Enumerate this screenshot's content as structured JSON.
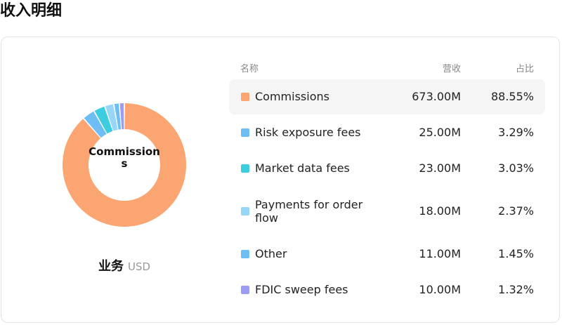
{
  "page": {
    "title": "收入明细"
  },
  "legend_caption": {
    "label": "业务",
    "currency": "USD"
  },
  "table": {
    "headers": {
      "name": "名称",
      "revenue": "营收",
      "share": "占比"
    },
    "rows": [
      {
        "name": "Commissions",
        "revenue": "673.00M",
        "share": "88.55%",
        "active": true
      },
      {
        "name": "Risk exposure fees",
        "revenue": "25.00M",
        "share": "3.29%",
        "active": false
      },
      {
        "name": "Market data fees",
        "revenue": "23.00M",
        "share": "3.03%",
        "active": false
      },
      {
        "name": "Payments for order flow",
        "revenue": "18.00M",
        "share": "2.37%",
        "active": false
      },
      {
        "name": "Other",
        "revenue": "11.00M",
        "share": "1.45%",
        "active": false
      },
      {
        "name": "FDIC sweep fees",
        "revenue": "10.00M",
        "share": "1.32%",
        "active": false
      }
    ]
  },
  "chart_data": {
    "type": "pie",
    "center_label": "Commissions",
    "categories": [
      "Commissions",
      "Risk exposure fees",
      "Market data fees",
      "Payments for order flow",
      "Other",
      "FDIC sweep fees"
    ],
    "values": [
      673.0,
      25.0,
      23.0,
      18.0,
      11.0,
      10.0
    ],
    "unit": "M USD",
    "percentages": [
      88.55,
      3.29,
      3.03,
      2.37,
      1.45,
      1.32
    ],
    "colors": [
      "#fba672",
      "#6cbef5",
      "#3ecce0",
      "#97d6f7",
      "#6cbef5",
      "#9c9cf5"
    ],
    "donut": true
  }
}
